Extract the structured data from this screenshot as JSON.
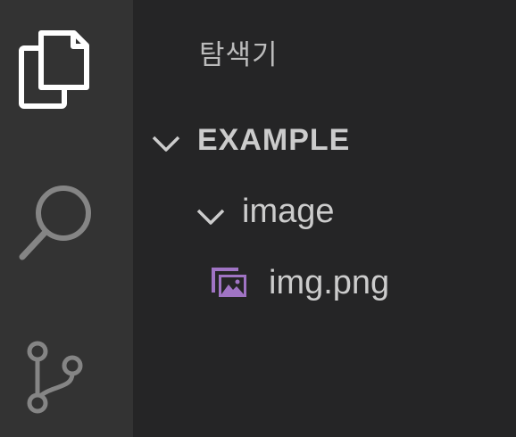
{
  "activity_bar": {
    "items": [
      {
        "name": "explorer",
        "icon": "files-icon",
        "active": true
      },
      {
        "name": "search",
        "icon": "search-icon",
        "active": false
      },
      {
        "name": "source-control",
        "icon": "source-control-icon",
        "active": false
      }
    ]
  },
  "sidebar": {
    "title": "탐색기",
    "section": {
      "label": "EXAMPLE",
      "expanded": true
    },
    "tree": {
      "folder": {
        "label": "image",
        "expanded": true
      },
      "file": {
        "label": "img.png",
        "icon": "image-file-icon"
      }
    }
  },
  "colors": {
    "activity_bar_bg": "#333333",
    "sidebar_bg": "#252526",
    "active_icon": "#ffffff",
    "inactive_icon": "#858585",
    "text": "#cccccc",
    "image_icon": "#a074c4"
  }
}
